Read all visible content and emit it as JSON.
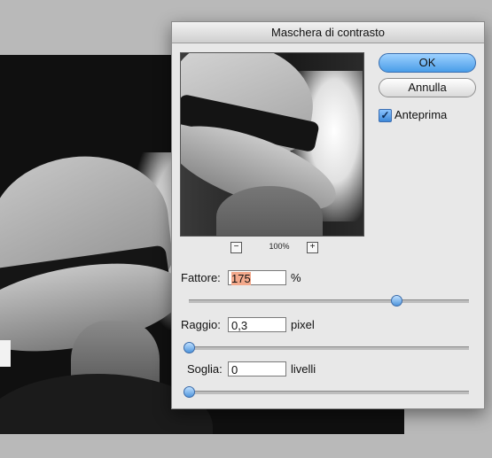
{
  "dialog": {
    "title": "Maschera di contrasto",
    "ok_label": "OK",
    "cancel_label": "Annulla",
    "preview_checkbox_label": "Anteprima",
    "preview_checked": true,
    "zoom": {
      "value": "100%",
      "minus": "−",
      "plus": "+"
    },
    "amount": {
      "label": "Fattore:",
      "value": "175",
      "unit": "%",
      "slider_fraction": 0.74
    },
    "radius": {
      "label": "Raggio:",
      "value": "0,3",
      "unit": "pixel",
      "slider_fraction": 0.0
    },
    "threshold": {
      "label": "Soglia:",
      "value": "0",
      "unit": "livelli",
      "slider_fraction": 0.0
    }
  },
  "colors": {
    "ok_button": "#4a9de8",
    "amount_highlight": "#f3a98c"
  }
}
